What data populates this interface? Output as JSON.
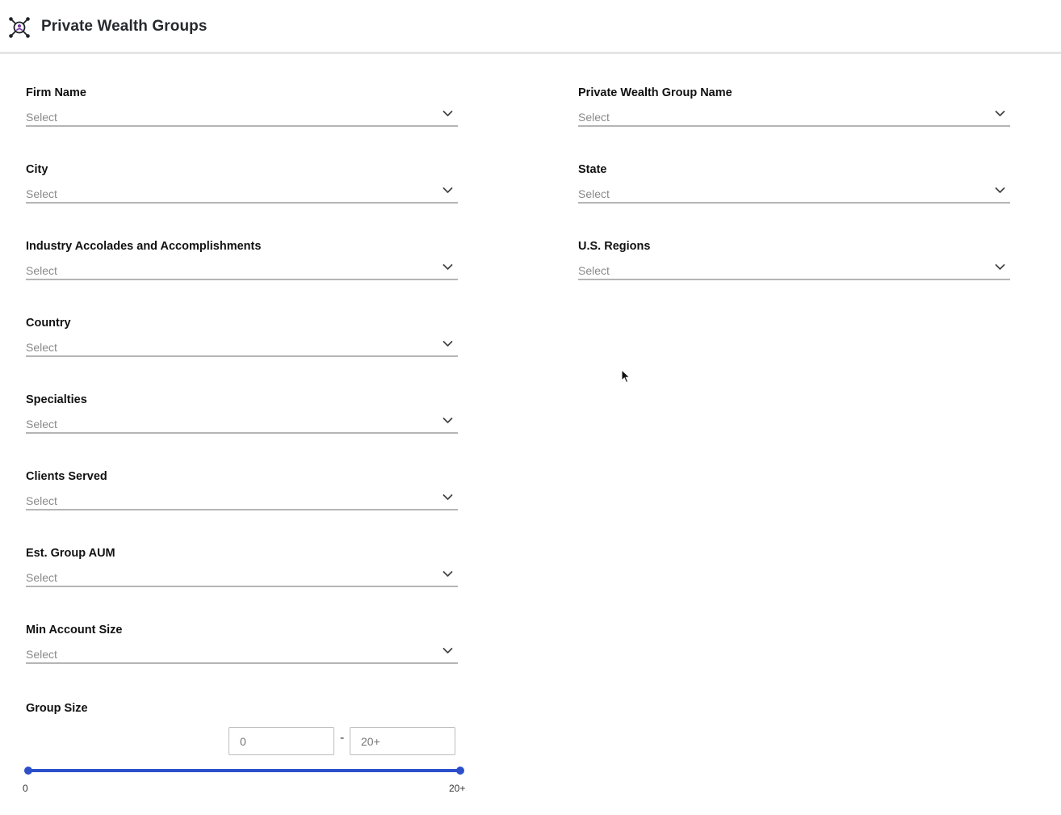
{
  "header": {
    "title": "Private Wealth Groups",
    "logo_icon": "network-person-icon"
  },
  "fields": {
    "firm_name": {
      "label": "Firm Name",
      "placeholder": "Select"
    },
    "pwg_name": {
      "label": "Private Wealth Group Name",
      "placeholder": "Select"
    },
    "city": {
      "label": "City",
      "placeholder": "Select"
    },
    "state": {
      "label": "State",
      "placeholder": "Select"
    },
    "accolades": {
      "label": "Industry Accolades and Accomplishments",
      "placeholder": "Select"
    },
    "us_regions": {
      "label": "U.S. Regions",
      "placeholder": "Select"
    },
    "country": {
      "label": "Country",
      "placeholder": "Select"
    },
    "specialties": {
      "label": "Specialties",
      "placeholder": "Select"
    },
    "clients_served": {
      "label": "Clients Served",
      "placeholder": "Select"
    },
    "group_aum": {
      "label": "Est. Group AUM",
      "placeholder": "Select"
    },
    "min_account": {
      "label": "Min Account Size",
      "placeholder": "Select"
    }
  },
  "group_size": {
    "label": "Group Size",
    "min_placeholder": "0",
    "max_placeholder": "20+",
    "separator": "-",
    "min_tick": "0",
    "max_tick": "20+",
    "slider_range_fraction": [
      0,
      1
    ]
  },
  "colors": {
    "accent": "#2c4fc9",
    "underline": "#b5b5b5",
    "placeholder": "#8a8a8a"
  }
}
